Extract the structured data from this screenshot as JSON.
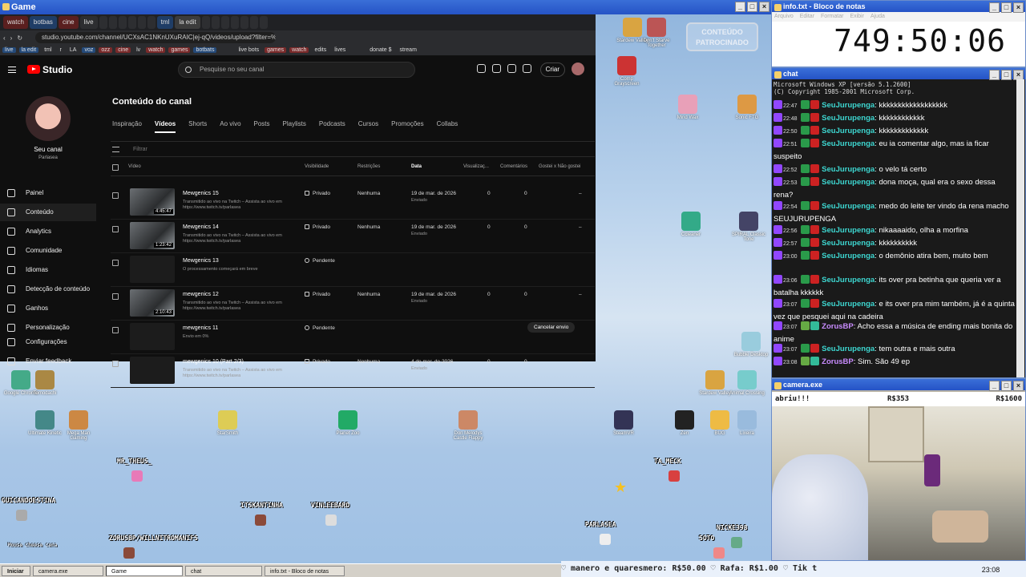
{
  "game_window": {
    "title": "Game"
  },
  "browser": {
    "tabs": [
      "watch",
      "botbas",
      "cine",
      "live",
      "",
      "",
      "",
      "",
      "",
      "",
      "tml",
      "la edit",
      "",
      "",
      "",
      "",
      "",
      "",
      ""
    ],
    "url": "studio.youtube.com/channel/UCXsAC1NKnUXuRAIC|ej-qQ/videos/upload?filter=%5B...",
    "bookmarks": [
      "live",
      "la edit",
      "tml",
      "r",
      "LA",
      "voz",
      "ozz",
      "cine",
      "lv",
      "watch",
      "games",
      "botbats",
      "",
      "",
      "live bots",
      "games",
      "watch",
      "edits",
      "lives",
      "",
      "",
      "donate $",
      "stream",
      ""
    ]
  },
  "studio": {
    "logo": "Studio",
    "search_placeholder": "Pesquise no seu canal",
    "create_label": "Criar",
    "channel_name": "Seu canal",
    "channel_handle": "Parlasea",
    "nav": [
      "Painel",
      "Conteúdo",
      "Analytics",
      "Comunidade",
      "Idiomas",
      "Detecção de conteúdo",
      "Ganhos",
      "Personalização",
      "Configurações",
      "Enviar feedback"
    ],
    "page_title": "Conteúdo do canal",
    "tabs": [
      "Inspiração",
      "Vídeos",
      "Shorts",
      "Ao vivo",
      "Posts",
      "Playlists",
      "Podcasts",
      "Cursos",
      "Promoções",
      "Collabs"
    ],
    "filter_placeholder": "Filtrar",
    "columns": [
      "Vídeo",
      "Visibilidade",
      "Restrições",
      "Data",
      "Visualizaç...",
      "Comentários",
      "Gostei x Não gostei"
    ],
    "videos": [
      {
        "title": "Mewgenics 15",
        "desc": "Transmitido ao vivo na Twitch – Assista ao vivo em https://www.twitch.tv/parlasea",
        "duration": "4:45:47",
        "visibility": "Privado",
        "restrictions": "Nenhuma",
        "date": "19 de mar. de 2026",
        "date_sub": "Enviado",
        "views": "0",
        "comments": "0",
        "likes": "–"
      },
      {
        "title": "Mewgenics 14",
        "desc": "Transmitido ao vivo na Twitch – Assista ao vivo em https://www.twitch.tv/parlasea",
        "duration": "1:23:42",
        "visibility": "Privado",
        "restrictions": "Nenhuma",
        "date": "19 de mar. de 2026",
        "date_sub": "Enviado",
        "views": "0",
        "comments": "0",
        "likes": "–"
      },
      {
        "title": "Mewgenics 13",
        "desc": "O processamento começará em breve",
        "duration": "",
        "visibility": "Pendente",
        "restrictions": "",
        "date": "",
        "date_sub": "",
        "views": "",
        "comments": "",
        "likes": ""
      },
      {
        "title": "mewgenics 12",
        "desc": "Transmitido ao vivo na Twitch – Assista ao vivo em https://www.twitch.tv/parlasea",
        "duration": "2:10:43",
        "visibility": "Privado",
        "restrictions": "Nenhuma",
        "date": "19 de mar. de 2026",
        "date_sub": "Enviado",
        "views": "0",
        "comments": "0",
        "likes": "–"
      },
      {
        "title": "mewgenics 11",
        "desc": "Envio em 0%",
        "duration": "",
        "visibility": "Pendente",
        "restrictions": "",
        "date": "",
        "date_sub": "",
        "views": "",
        "comments": "",
        "likes": "",
        "action": "Cancelar envio"
      },
      {
        "title": "mewgenics 10 (Part 2/3)",
        "desc": "Transmitido ao vivo na Twitch – Assista ao vivo em https://www.twitch.tv/parlasea",
        "duration": "",
        "visibility": "Privado",
        "restrictions": "Nenhuma",
        "date": "4 de mar. de 2026",
        "date_sub": "Enviado",
        "views": "0",
        "comments": "0",
        "likes": "–"
      }
    ]
  },
  "desktop_icons": [
    {
      "label": "Stardew Valley",
      "color": "#d9a441"
    },
    {
      "label": "Don't Starve Together",
      "color": "#b55"
    },
    {
      "label": "Comp Grayscreen",
      "color": "#c33"
    },
    {
      "label": "Mind Wax",
      "color": "#e8a0b8"
    },
    {
      "label": "Sonic FTG",
      "color": "#d94"
    },
    {
      "label": "Ccleaner",
      "color": "#3a8"
    },
    {
      "label": "SPIRAL Classic Tone",
      "color": "#446"
    },
    {
      "label": "Bubble Desktop",
      "color": "#9cd"
    },
    {
      "label": "Google Chrome",
      "color": "#4a8"
    },
    {
      "label": "Tomodachi",
      "color": "#a84"
    },
    {
      "label": "Ultimate Kinetic",
      "color": "#488"
    },
    {
      "label": "Mega Man Gaming",
      "color": "#c84"
    },
    {
      "label": "StarSmith",
      "color": "#dc5"
    },
    {
      "label": "Planet Zoo",
      "color": "#2a6"
    },
    {
      "label": "Don Melodys Castle Flappy",
      "color": "#c86"
    },
    {
      "label": "SteamVR",
      "color": "#335"
    },
    {
      "label": "Zen",
      "color": "#222"
    },
    {
      "label": "BUG",
      "color": "#eb4"
    },
    {
      "label": "Lixeira",
      "color": "#9bd"
    },
    {
      "label": "Stardew Valley",
      "color": "#d9a441"
    },
    {
      "label": "Animal Crossing",
      "color": "#7cc"
    }
  ],
  "overlay_names": [
    "MR_THEUS_",
    "TA_MECK",
    "GUICANDOESTINA",
    "ITSKANTINHA",
    "VINLEEBARD",
    "PARLASEA",
    "NICKE398",
    "ZORUSBP/WILLNITROMANIFS",
    "SOTO",
    "Mouse cheese cena"
  ],
  "sponsor": "CONTEÚDO PATROCINADO",
  "notepad": {
    "title": "info.txt - Bloco de notas",
    "menu": [
      "Arquivo",
      "Editar",
      "Formatar",
      "Exibir",
      "Ajuda"
    ],
    "timer": "749:50:06"
  },
  "chat": {
    "title": "chat",
    "header": "Microsoft Windows XP [versão 5.1.2600]\n(C) Copyright 1985-2001 Microsoft Corp.",
    "messages": [
      {
        "time": "22:47",
        "user": "SeuJurupenga",
        "color": "#3dd6d0",
        "text": "kkkkkkkkkkkkkkkkkk"
      },
      {
        "time": "22:48",
        "user": "SeuJurupenga",
        "color": "#3dd6d0",
        "text": "kkkkkkkkkkkk"
      },
      {
        "time": "22:50",
        "user": "SeuJurupenga",
        "color": "#3dd6d0",
        "text": "kkkkkkkkkkkkk"
      },
      {
        "time": "22:51",
        "user": "SeuJurupenga",
        "color": "#3dd6d0",
        "text": "eu ia comentar algo, mas ia ficar suspeito"
      },
      {
        "time": "22:52",
        "user": "SeuJurupenga",
        "color": "#3dd6d0",
        "text": "o velo tá certo"
      },
      {
        "time": "22:53",
        "user": "SeuJurupenga",
        "color": "#3dd6d0",
        "text": "dona moça, qual era o sexo dessa rena?"
      },
      {
        "time": "22:54",
        "user": "SeuJurupenga",
        "color": "#3dd6d0",
        "text": "medo do leite ter vindo da rena macho SEUJURUPENGA"
      },
      {
        "time": "22:56",
        "user": "SeuJurupenga",
        "color": "#3dd6d0",
        "text": "nikaaaaido, olha a morfina"
      },
      {
        "time": "22:57",
        "user": "SeuJurupenga",
        "color": "#3dd6d0",
        "text": "kkkkkkkkkk"
      },
      {
        "time": "23:00",
        "user": "SeuJurupenga",
        "color": "#3dd6d0",
        "text": "o demônio atira bem, muito bem"
      },
      {
        "time": "23:06",
        "user": "SeuJurupenga",
        "color": "#3dd6d0",
        "text": "its over pra betinha que queria ver a batalha kkkkkk"
      },
      {
        "time": "23:07",
        "user": "SeuJurupenga",
        "color": "#3dd6d0",
        "text": "e its over pra mim também, já é a quinta vez que pesquei aqui na cadeira"
      },
      {
        "time": "23:07",
        "user": "ZorusBP",
        "color": "#c98cff",
        "text": "Acho essa a música de ending mais bonita do anime"
      },
      {
        "time": "23:07",
        "user": "SeuJurupenga",
        "color": "#3dd6d0",
        "text": "tem outra e mais outra"
      },
      {
        "time": "23:08",
        "user": "ZorusBP",
        "color": "#c98cff",
        "text": "Sim. São 49 ep"
      }
    ]
  },
  "camera": {
    "title": "camera.exe",
    "top_left": "abriu!!!",
    "top_mid": "R$353",
    "top_right": "R$1600"
  },
  "ticker": "♡ manero e quaresmero: R$50.00 ♡ Rafa: R$1.00 ♡ Tik t",
  "taskbar": {
    "start": "Iniciar",
    "items": [
      "camera.exe",
      "Game",
      "chat",
      "info.txt - Bloco de notas"
    ],
    "clock": "23:08"
  }
}
